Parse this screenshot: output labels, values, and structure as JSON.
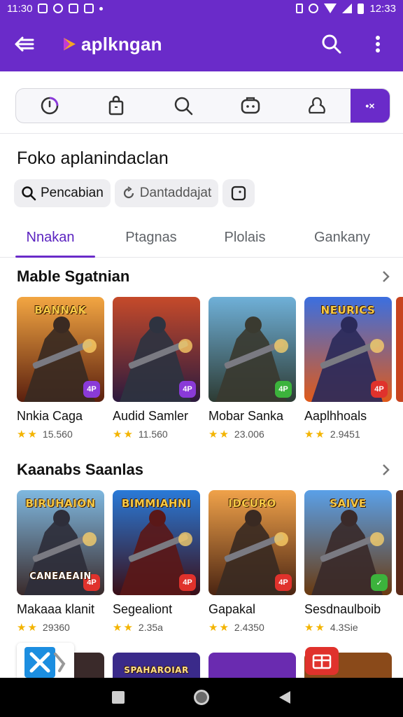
{
  "status_bar": {
    "time_left": "11:30",
    "time_right": "12:33"
  },
  "app_bar": {
    "title": "aplkngan"
  },
  "filter_bar": {
    "icons": [
      "clock-icon",
      "shopping-bag-icon",
      "search-icon",
      "gamepad-icon",
      "profile-icon"
    ],
    "active_label": "•×"
  },
  "heading": "Foko aplanindaclan",
  "chips": [
    {
      "label": "Pencabian",
      "icon": "search-icon"
    },
    {
      "label": "Dantaddajat",
      "icon": "refresh-icon"
    },
    {
      "label": "",
      "icon": "square-icon"
    }
  ],
  "tabs": [
    {
      "label": "Nnakan",
      "active": true
    },
    {
      "label": "Ptagnas",
      "active": false
    },
    {
      "label": "Plolais",
      "active": false
    },
    {
      "label": "Gankany",
      "active": false
    }
  ],
  "sections": [
    {
      "title": "Mable Sgatnian",
      "cards": [
        {
          "name": "Nnkia Caga",
          "rating": "15.560",
          "art_text": "BANNAK",
          "badge": "4P",
          "badge_color": "#8a3ad8",
          "bg_top": "#f3a642",
          "bg_bottom": "#5a1f0e",
          "figure": "#3a2a22"
        },
        {
          "name": "Audid Samler",
          "rating": "11.560",
          "art_text": "",
          "badge": "4P",
          "badge_color": "#8a3ad8",
          "bg_top": "#c64a2a",
          "bg_bottom": "#2c1a3e",
          "figure": "#2e3340"
        },
        {
          "name": "Mobar Sanka",
          "rating": "23.006",
          "art_text": "",
          "badge": "4P",
          "badge_color": "#3cb33c",
          "bg_top": "#6fb0d8",
          "bg_bottom": "#2d3b33",
          "figure": "#3a3a30"
        },
        {
          "name": "Aaplhhoals",
          "rating": "2.9451",
          "art_text": "NEURICS",
          "badge": "4P",
          "badge_color": "#e0322c",
          "bg_top": "#3b6fe0",
          "bg_bottom": "#e05a1a",
          "figure": "#2b2a5a"
        }
      ]
    },
    {
      "title": "Kaanabs Saanlas",
      "cards": [
        {
          "name": "Makaaa klanit",
          "rating": "29360",
          "art_text": "BIRUHAION",
          "badge": "4P",
          "badge_color": "#e0322c",
          "bg_top": "#7fb8e0",
          "bg_bottom": "#3a2a2a",
          "figure": "#2e2e3a"
        },
        {
          "name": "Segealiont",
          "rating": "2.35a",
          "art_text": "BIMMIAHNI",
          "badge": "4P",
          "badge_color": "#e0322c",
          "bg_top": "#2a7ad8",
          "bg_bottom": "#3a0e16",
          "figure": "#5a1818"
        },
        {
          "name": "Gapakal",
          "rating": "2.4350",
          "art_text": "IDCURO",
          "badge": "4P",
          "badge_color": "#e0322c",
          "bg_top": "#f0a24a",
          "bg_bottom": "#4a2412",
          "figure": "#3a2a22"
        },
        {
          "name": "Sesdnaulboib",
          "rating": "4.3Sie",
          "art_text": "SAIVE",
          "badge": "✓",
          "badge_color": "#3cb33c",
          "bg_top": "#5aa0e8",
          "bg_bottom": "#6a3a10",
          "figure": "#3a2a2a"
        }
      ],
      "extra_labels": {
        "card1_caption": "CANEAEAIN"
      }
    }
  ],
  "bottom_row": [
    {
      "art_text": "",
      "bg": "#3a2a2a"
    },
    {
      "art_text": "SPAHAROIAR",
      "bg": "#3a2a8a"
    },
    {
      "art_text": "",
      "bg": "#6a2bb0"
    },
    {
      "art_text": "",
      "bg": "#8a4a1a"
    }
  ]
}
